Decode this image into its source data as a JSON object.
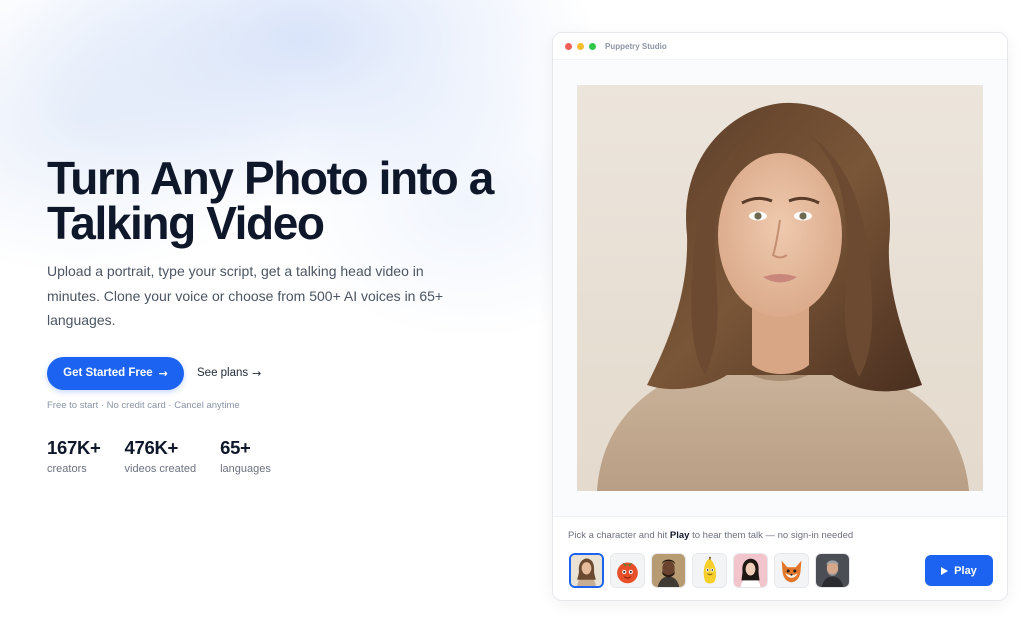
{
  "hero": {
    "title_line1": "Turn Any Photo into a",
    "title_line2": "Talking Video",
    "subtitle": "Upload a portrait, type your script, get a talking head video in minutes. Clone your voice or choose from 500+ AI voices in 65+ languages.",
    "cta_primary": "Get Started Free",
    "cta_secondary": "See plans",
    "fineprint": "Free to start · No credit card · Cancel anytime",
    "stats": [
      {
        "value": "167K+",
        "label": "creators"
      },
      {
        "value": "476K+",
        "label": "videos created"
      },
      {
        "value": "65+",
        "label": "languages"
      }
    ]
  },
  "app_window": {
    "title": "Puppetry Studio",
    "picker_hint_before": "Pick a character and hit ",
    "picker_hint_bold": "Play",
    "picker_hint_after": " to hear them talk — no sign-in needed",
    "play_label": "Play",
    "characters": [
      {
        "name": "woman-brunette",
        "selected": true
      },
      {
        "name": "tomato-character",
        "selected": false
      },
      {
        "name": "bearded-man",
        "selected": false
      },
      {
        "name": "banana-character",
        "selected": false
      },
      {
        "name": "woman-dark-hair",
        "selected": false
      },
      {
        "name": "fox-character",
        "selected": false
      },
      {
        "name": "older-man",
        "selected": false
      }
    ]
  },
  "colors": {
    "accent": "#1d63f2",
    "title": "#0f172a",
    "muted": "#6b7280"
  }
}
